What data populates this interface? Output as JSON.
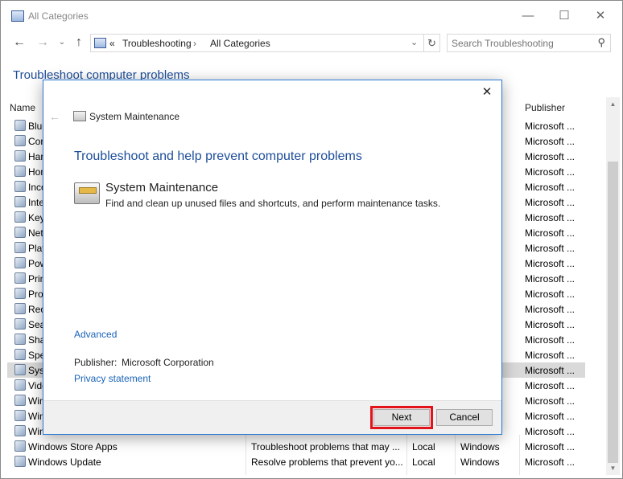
{
  "window": {
    "title": "All Categories",
    "controls": {
      "minimize": "—",
      "maximize": "☐",
      "close": "✕"
    }
  },
  "address_bar": {
    "chevrons": "«",
    "crumbs": [
      "Troubleshooting",
      "All Categories"
    ],
    "dropdown": "⌄",
    "refresh": "↻"
  },
  "search": {
    "placeholder": "Search Troubleshooting"
  },
  "main_title": "Troubleshoot computer problems",
  "list": {
    "columns": {
      "name": "Name",
      "publisher": "Publisher"
    },
    "rows": [
      {
        "name": "Blue",
        "publisher": "Microsoft ..."
      },
      {
        "name": "Con",
        "publisher": "Microsoft ..."
      },
      {
        "name": "Har",
        "publisher": "Microsoft ..."
      },
      {
        "name": "Hon",
        "publisher": "Microsoft ..."
      },
      {
        "name": "Inco",
        "publisher": "Microsoft ..."
      },
      {
        "name": "Inte",
        "publisher": "Microsoft ..."
      },
      {
        "name": "Key",
        "publisher": "Microsoft ..."
      },
      {
        "name": "Net",
        "publisher": "Microsoft ..."
      },
      {
        "name": "Play",
        "publisher": "Microsoft ..."
      },
      {
        "name": "Pow",
        "publisher": "Microsoft ..."
      },
      {
        "name": "Prin",
        "publisher": "Microsoft ..."
      },
      {
        "name": "Pro",
        "publisher": "Microsoft ..."
      },
      {
        "name": "Rec",
        "publisher": "Microsoft ..."
      },
      {
        "name": "Sea",
        "publisher": "Microsoft ..."
      },
      {
        "name": "Sha",
        "publisher": "Microsoft ..."
      },
      {
        "name": "Spe",
        "publisher": "Microsoft ..."
      },
      {
        "name": "Syst",
        "publisher": "Microsoft ...",
        "selected": true
      },
      {
        "name": "Vide",
        "publisher": "Microsoft ..."
      },
      {
        "name": "Win",
        "publisher": "Microsoft ..."
      },
      {
        "name": "Win",
        "publisher": "Microsoft ..."
      },
      {
        "name": "Wind",
        "publisher": "Microsoft ..."
      },
      {
        "name": "Windows Store Apps",
        "description": "Troubleshoot problems that may ...",
        "location": "Local",
        "category": "Windows",
        "publisher": "Microsoft ..."
      },
      {
        "name": "Windows Update",
        "description": "Resolve problems that prevent yo...",
        "location": "Local",
        "category": "Windows",
        "publisher": "Microsoft ..."
      }
    ]
  },
  "dialog": {
    "close": "✕",
    "back": "←",
    "header_title": "System Maintenance",
    "heading": "Troubleshoot and help prevent computer problems",
    "item_title": "System Maintenance",
    "item_description": "Find and clean up unused files and shortcuts, and perform maintenance tasks.",
    "advanced_link": "Advanced",
    "publisher_label": "Publisher:",
    "publisher_value": "Microsoft Corporation",
    "privacy_link": "Privacy statement",
    "next_label": "Next",
    "cancel_label": "Cancel"
  },
  "icons": {
    "back": "arrow-left-icon",
    "forward": "arrow-right-icon",
    "up": "arrow-up-icon",
    "search": "magnifier-icon"
  },
  "colors": {
    "link": "#1a64b8",
    "heading": "#1e4e9a",
    "dialog_border": "#2b79d6",
    "highlight": "#e3131b",
    "selected_row": "#d9d9d9"
  }
}
